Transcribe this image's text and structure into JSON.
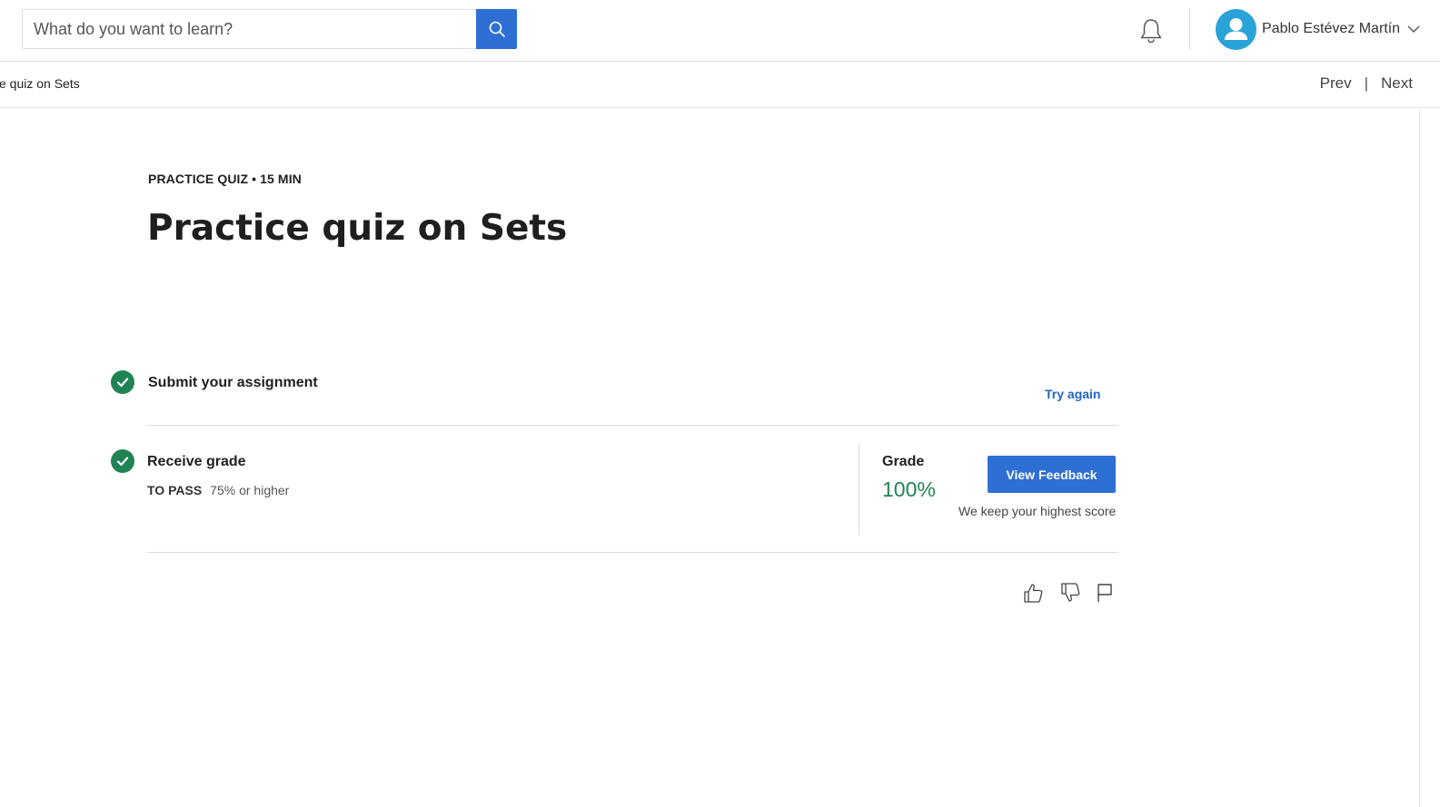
{
  "header": {
    "search": {
      "placeholder": "What do you want to learn?"
    },
    "user": {
      "name": "Pablo Estévez Martín"
    }
  },
  "subnav": {
    "breadcrumb": "ce quiz on Sets",
    "prev_label": "Prev",
    "separator": "|",
    "next_label": "Next"
  },
  "main": {
    "eyebrow": "PRACTICE QUIZ • 15 MIN",
    "title": "Practice quiz on Sets",
    "steps": [
      {
        "title": "Submit your assignment",
        "action_label": "Try again",
        "completed": true
      },
      {
        "title": "Receive grade",
        "to_pass_label": "TO PASS",
        "to_pass_value": "75% or higher",
        "completed": true
      }
    ],
    "grade": {
      "label": "Grade",
      "value": "100%",
      "button_label": "View Feedback",
      "note": "We keep your highest score"
    }
  },
  "colors": {
    "primary_blue": "#2d6fd2",
    "success_green": "#1f8354",
    "avatar_blue": "#29a2d8",
    "link_blue": "#2265c9"
  },
  "icons": [
    "search-icon",
    "bell-icon",
    "user-avatar-icon",
    "chevron-down-icon",
    "check-icon",
    "thumbs-up-icon",
    "thumbs-down-icon",
    "flag-icon"
  ]
}
